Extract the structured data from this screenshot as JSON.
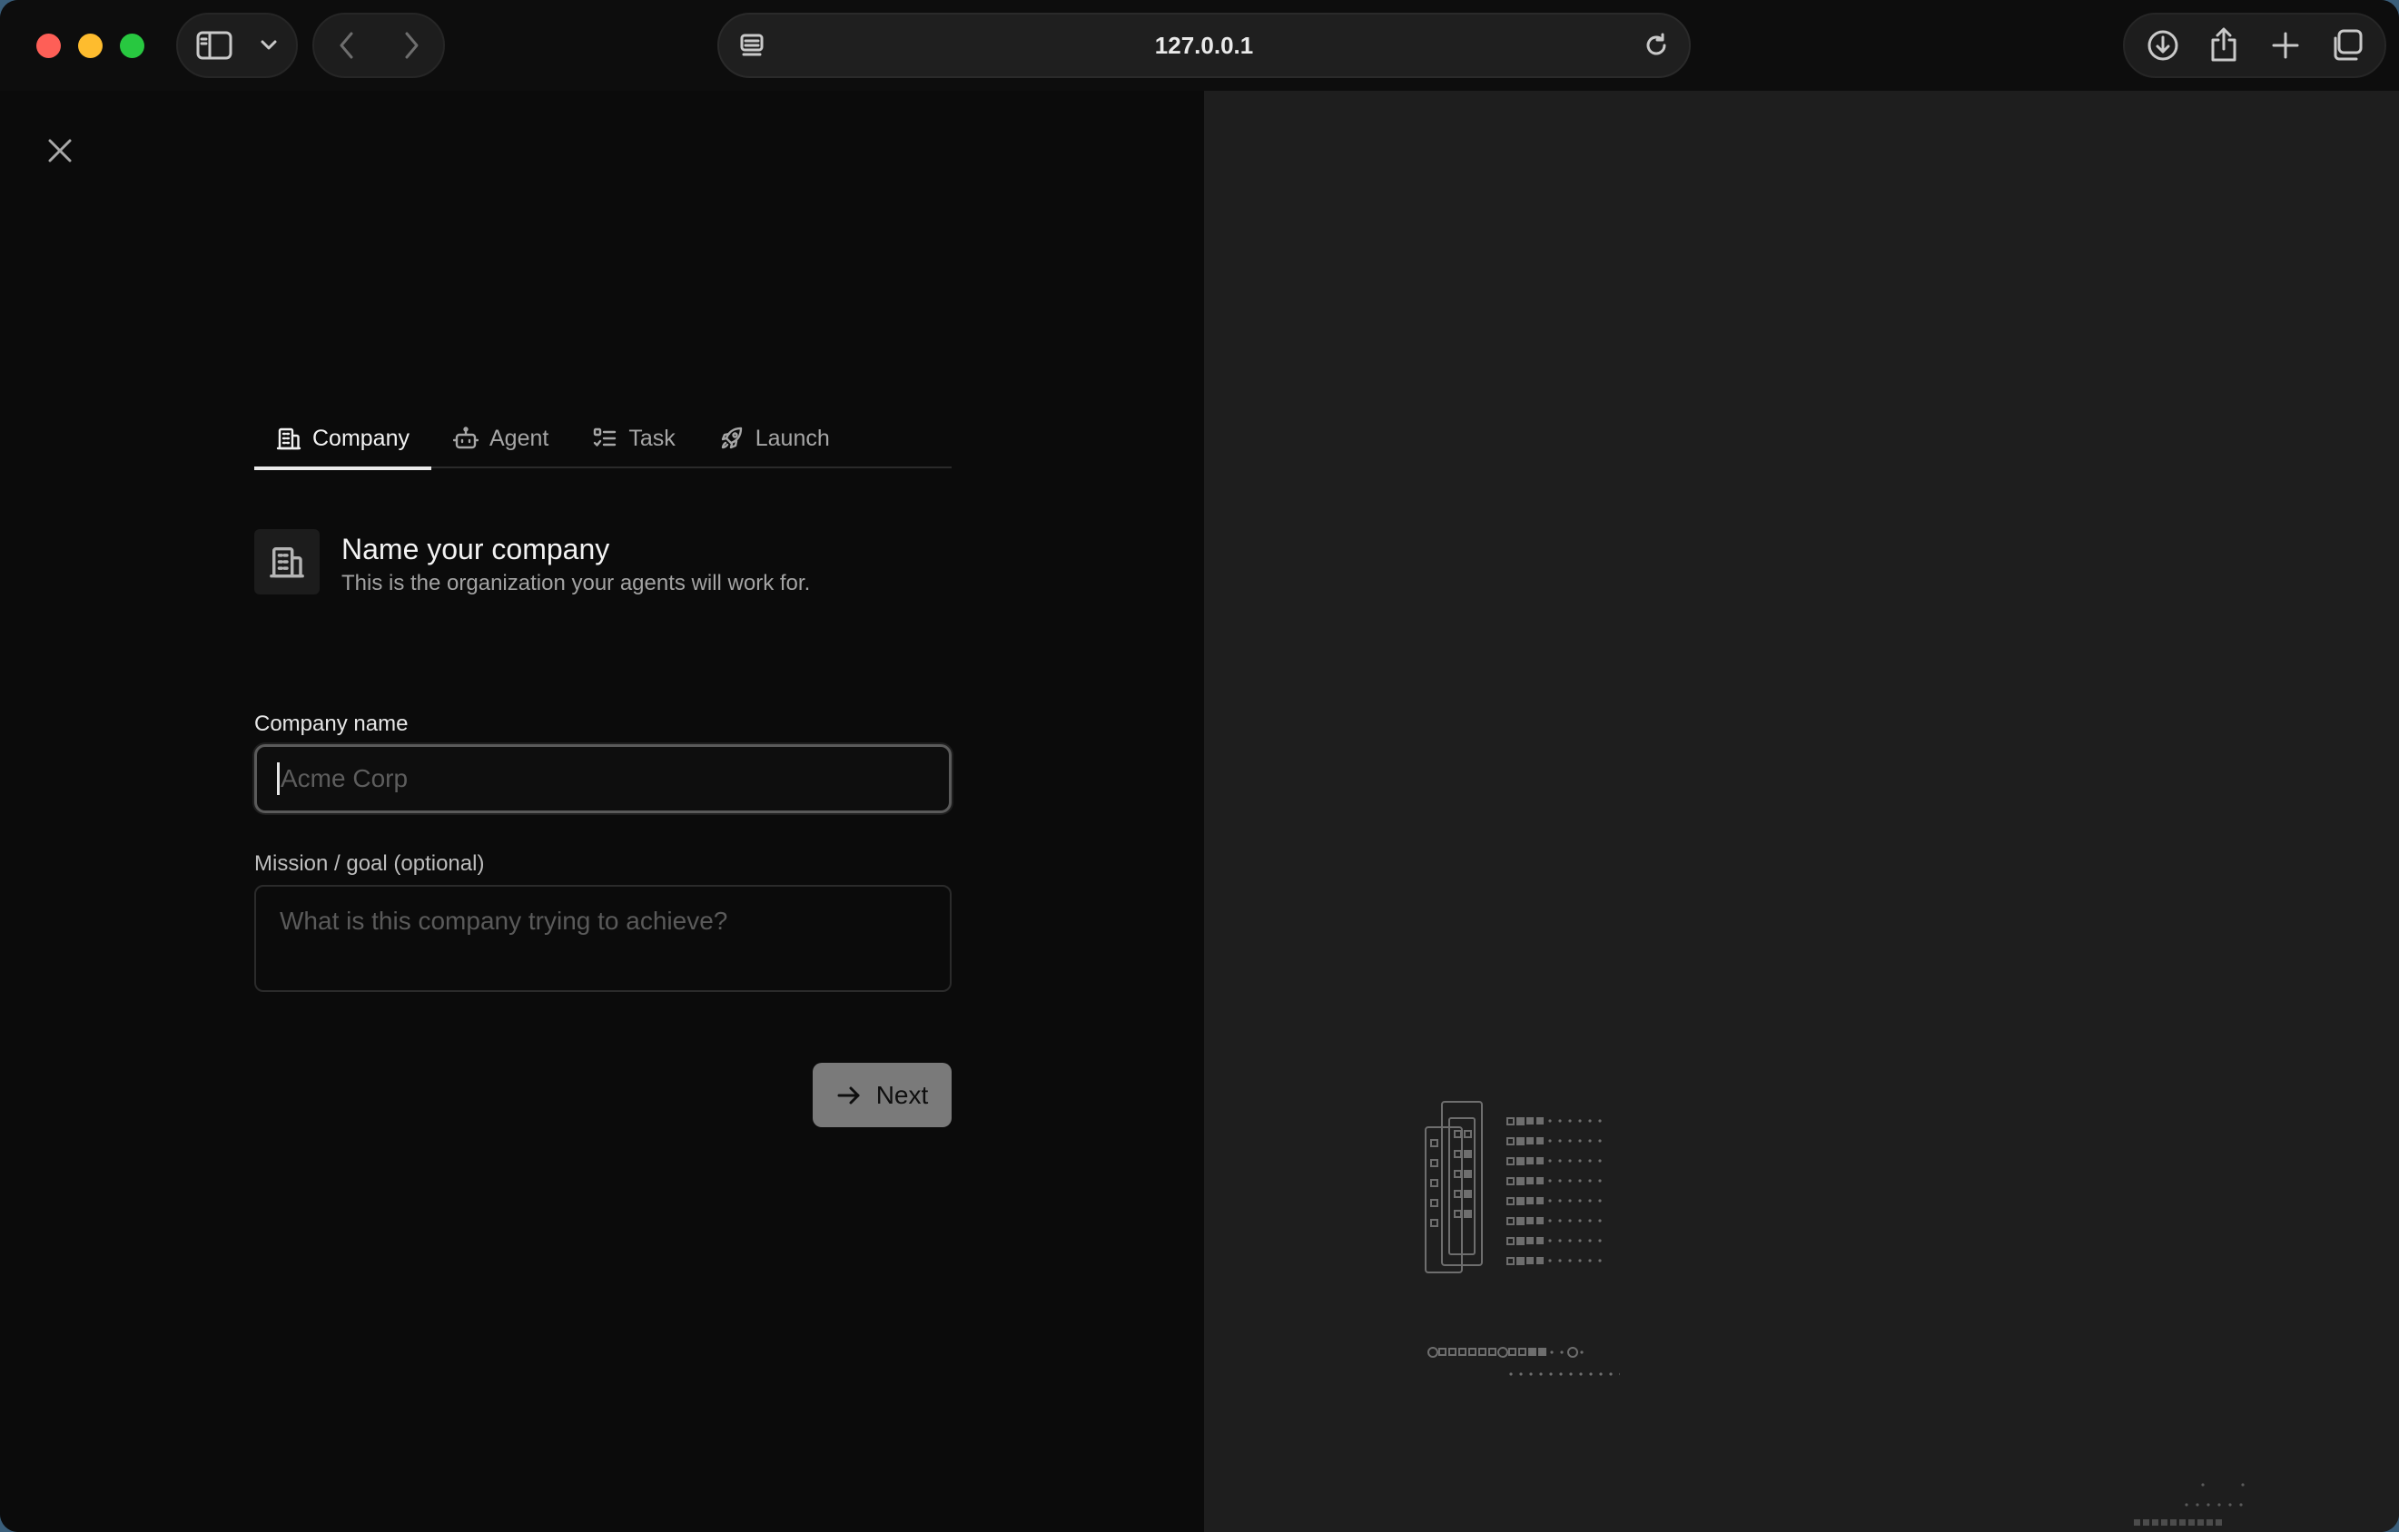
{
  "browser": {
    "url": "127.0.0.1",
    "icons": {
      "sidebar": "sidebar-icon",
      "chevron": "chevron-down-icon",
      "back": "chevron-left-icon",
      "forward": "chevron-right-icon",
      "reader": "reader-icon",
      "reload": "reload-icon",
      "download": "download-icon",
      "share": "share-icon",
      "new_tab": "plus-icon",
      "tabs": "tab-overview-icon"
    }
  },
  "wizard": {
    "tabs": [
      {
        "label": "Company",
        "icon": "building-icon",
        "active": true
      },
      {
        "label": "Agent",
        "icon": "robot-icon",
        "active": false
      },
      {
        "label": "Task",
        "icon": "list-check-icon",
        "active": false
      },
      {
        "label": "Launch",
        "icon": "rocket-icon",
        "active": false
      }
    ],
    "heading": {
      "title": "Name your company",
      "subtitle": "This is the organization your agents will work for.",
      "icon": "building-icon"
    },
    "company_field": {
      "label": "Company name",
      "value": "",
      "placeholder": "Acme Corp"
    },
    "mission_field": {
      "label": "Mission / goal (optional)",
      "value": "",
      "placeholder": "What is this company trying to achieve?"
    },
    "next_button": {
      "label": "Next",
      "icon": "arrow-right-icon"
    }
  },
  "colors": {
    "left_bg": "#0b0b0b",
    "right_bg": "#1e1e1e",
    "button_bg": "#7a7a7a",
    "active_tab_underline": "#eaeaea"
  }
}
